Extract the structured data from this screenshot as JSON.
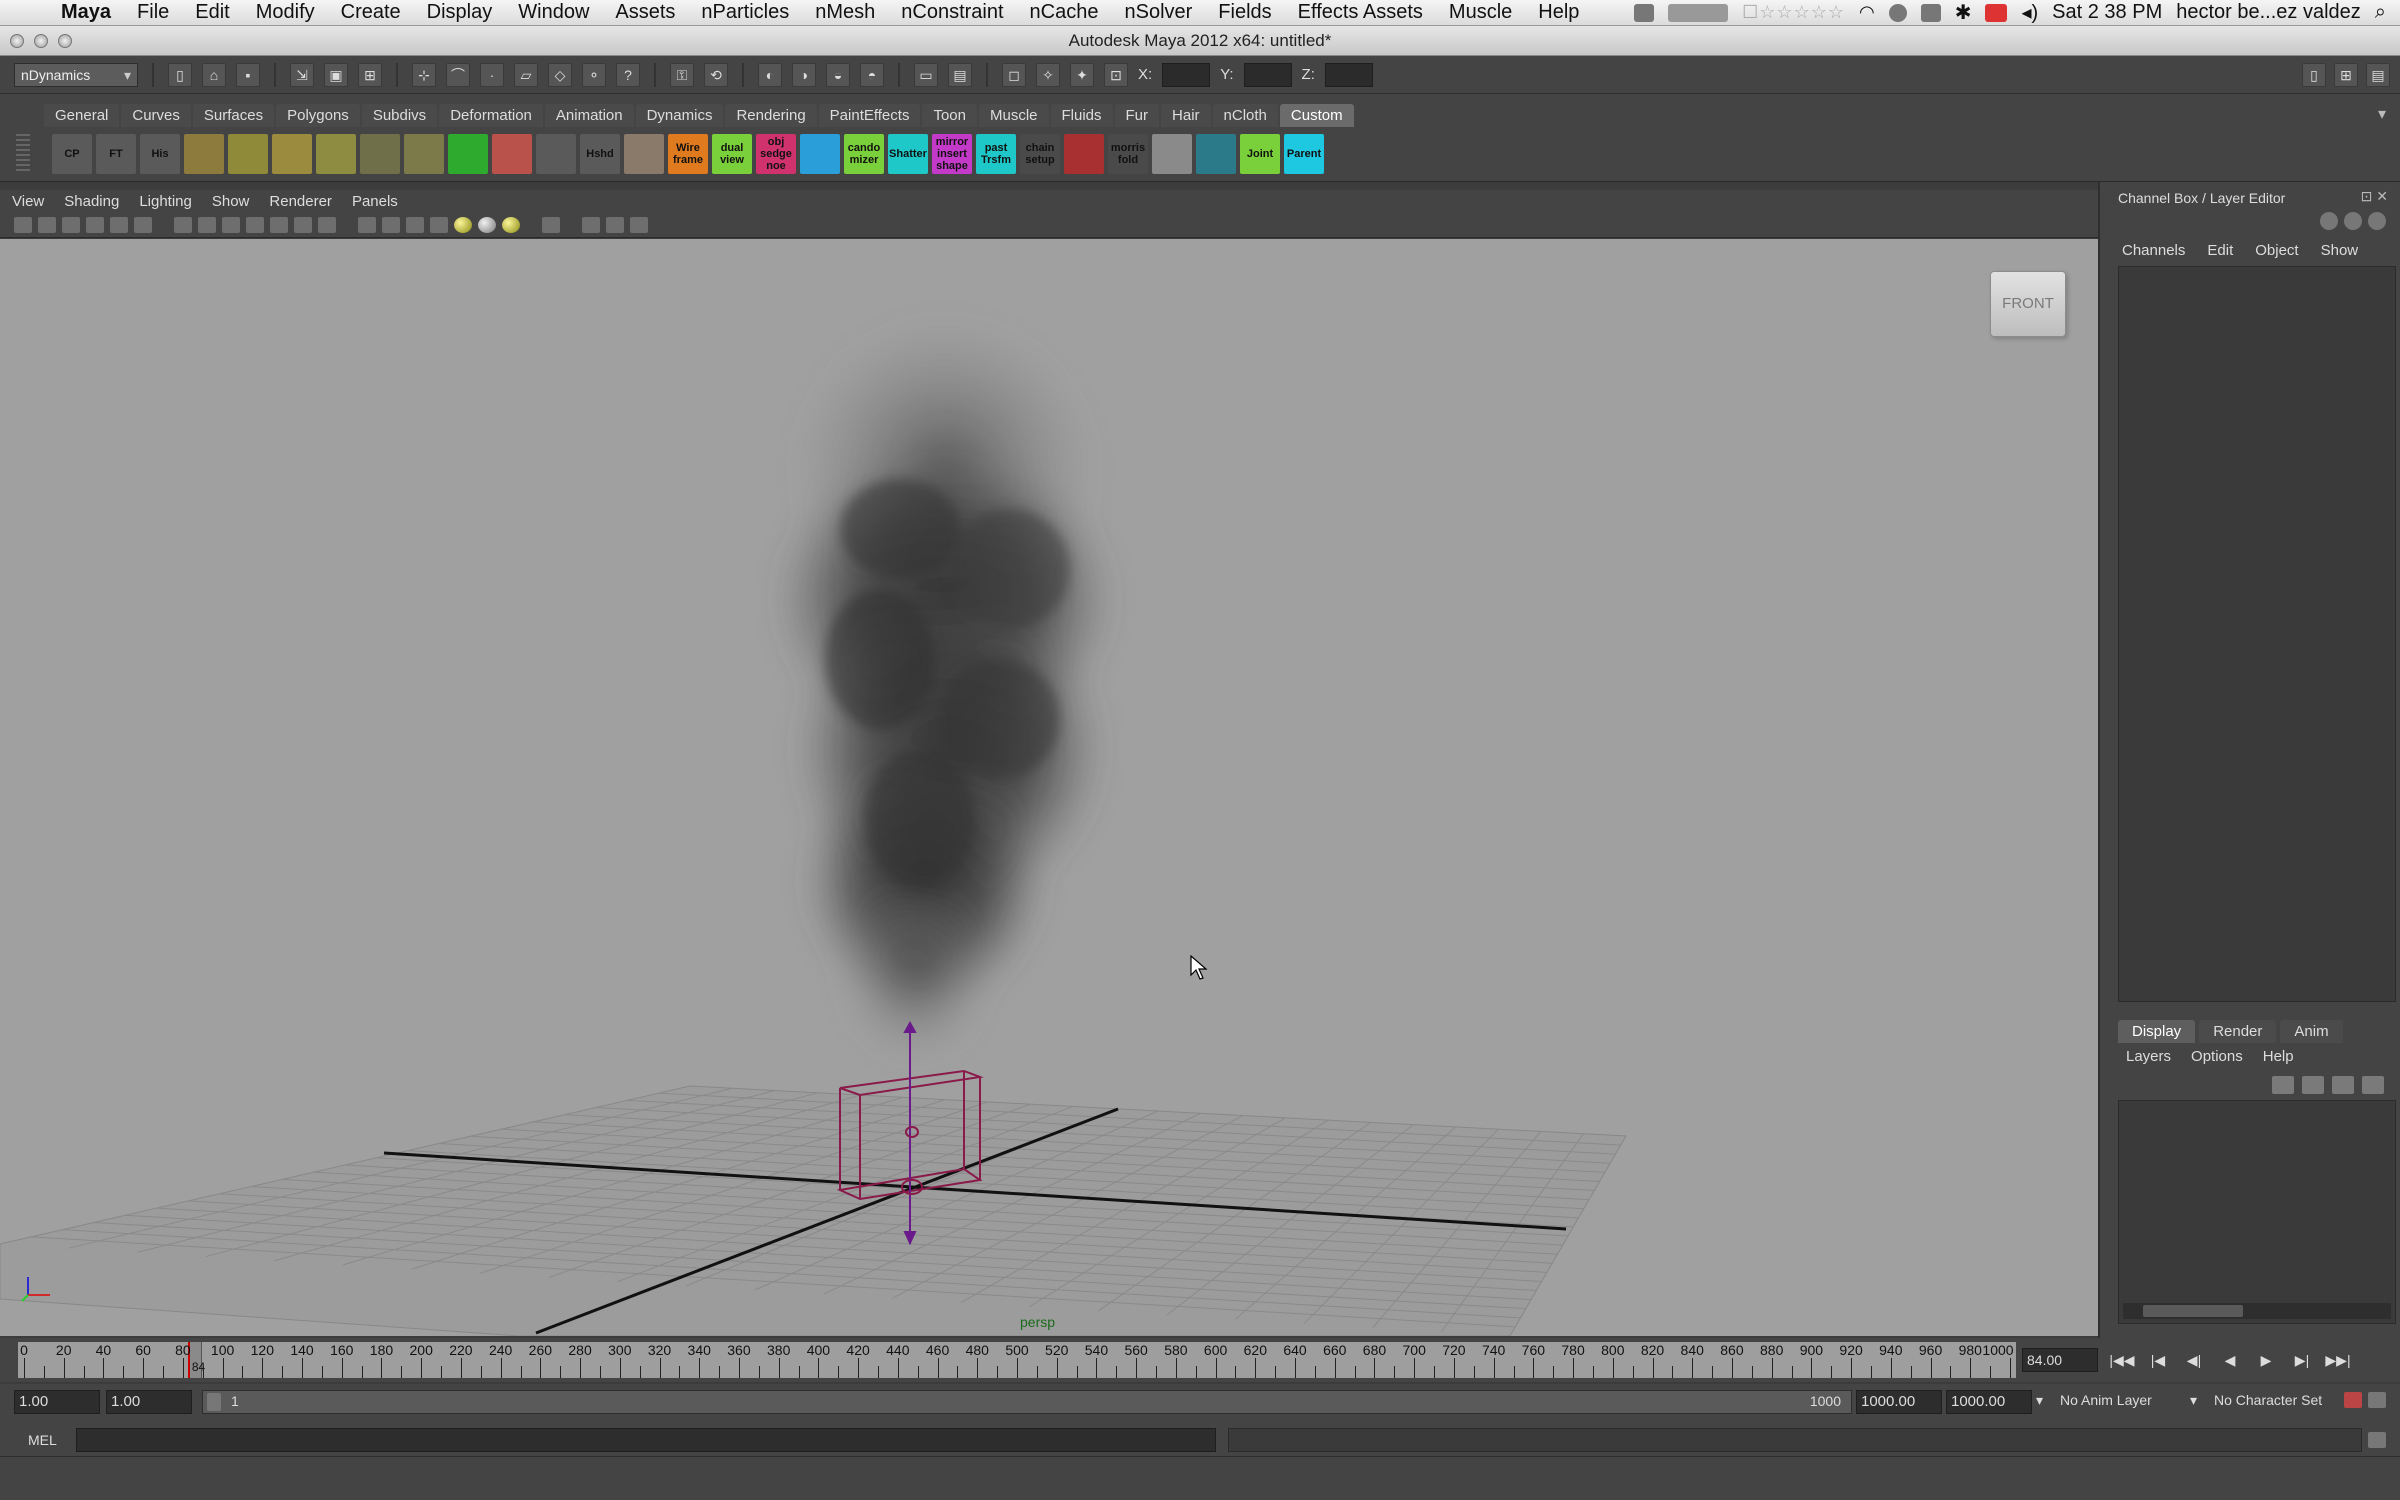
{
  "menubar": {
    "app": "Maya",
    "items": [
      "File",
      "Edit",
      "Modify",
      "Create",
      "Display",
      "Window",
      "Assets",
      "nParticles",
      "nMesh",
      "nConstraint",
      "nCache",
      "nSolver",
      "Fields",
      "Effects Assets",
      "Muscle",
      "Help"
    ],
    "clock": "Sat 2 38 PM",
    "user": "hector be...ez valdez"
  },
  "window": {
    "title": "Autodesk Maya 2012 x64: untitled*"
  },
  "statusline": {
    "menuset": "nDynamics",
    "x_label": "X:",
    "y_label": "Y:",
    "z_label": "Z:"
  },
  "shelf": {
    "tabs": [
      "General",
      "Curves",
      "Surfaces",
      "Polygons",
      "Subdivs",
      "Deformation",
      "Animation",
      "Dynamics",
      "Rendering",
      "PaintEffects",
      "Toon",
      "Muscle",
      "Fluids",
      "Fur",
      "Hair",
      "nCloth",
      "Custom"
    ],
    "active_tab": "Custom",
    "buttons": [
      {
        "label": "CP",
        "color": "#5a5a5a"
      },
      {
        "label": "FT",
        "color": "#5a5a5a"
      },
      {
        "label": "His",
        "color": "#5a5a5a"
      },
      {
        "label": "",
        "color": "#8c7b3c"
      },
      {
        "label": "",
        "color": "#8f8a3a"
      },
      {
        "label": "",
        "color": "#9a8b3e"
      },
      {
        "label": "",
        "color": "#8e8c40"
      },
      {
        "label": "",
        "color": "#6f6f4a"
      },
      {
        "label": "",
        "color": "#7d7a4a"
      },
      {
        "label": "",
        "color": "#2eaa2e"
      },
      {
        "label": "",
        "color": "#b9524a"
      },
      {
        "label": "",
        "color": "#5a5a5a"
      },
      {
        "label": "Hshd",
        "color": "#5a5a5a"
      },
      {
        "label": "",
        "color": "#8a7a6a"
      },
      {
        "label": "Wire frame",
        "color": "#e07a1e"
      },
      {
        "label": "dual view",
        "color": "#7ad03a"
      },
      {
        "label": "obj sedge noe",
        "color": "#d0326e"
      },
      {
        "label": "",
        "color": "#2a9ed8"
      },
      {
        "label": "cando mizer",
        "color": "#7ad03a"
      },
      {
        "label": "Shatter",
        "color": "#1ec8c8"
      },
      {
        "label": "mirror insert shape",
        "color": "#c43ac8"
      },
      {
        "label": "past Trsfm",
        "color": "#1ec8c8"
      },
      {
        "label": "chain setup",
        "color": "#4a4a4a"
      },
      {
        "label": "",
        "color": "#a83030"
      },
      {
        "label": "morris fold",
        "color": "#4a4a4a"
      },
      {
        "label": "",
        "color": "#8a8a8a"
      },
      {
        "label": "",
        "color": "#2a7a8a"
      },
      {
        "label": "Joint",
        "color": "#7ad03a"
      },
      {
        "label": "Parent",
        "color": "#1ec8e0"
      }
    ]
  },
  "panel": {
    "menu": [
      "View",
      "Shading",
      "Lighting",
      "Show",
      "Renderer",
      "Panels"
    ],
    "viewcube_label": "FRONT",
    "camera": "persp"
  },
  "channelbox": {
    "title": "Channel Box / Layer Editor",
    "menu": [
      "Channels",
      "Edit",
      "Object",
      "Show"
    ],
    "layer_tabs": [
      "Display",
      "Render",
      "Anim"
    ],
    "layer_menu": [
      "Layers",
      "Options",
      "Help"
    ]
  },
  "timeslider": {
    "ticks": [
      "0",
      "20",
      "40",
      "60",
      "80",
      "100",
      "120",
      "140",
      "160",
      "180",
      "200",
      "220",
      "240",
      "260",
      "280",
      "300",
      "320",
      "340",
      "360",
      "380",
      "400",
      "420",
      "440",
      "460",
      "480",
      "500",
      "520",
      "540",
      "560",
      "580",
      "600",
      "620",
      "640",
      "660",
      "680",
      "700",
      "720",
      "740",
      "760",
      "780",
      "800",
      "820",
      "840",
      "860",
      "880",
      "900",
      "920",
      "940",
      "960",
      "980",
      "1000"
    ],
    "current_frame_marker": "84",
    "current_frame": "84.00"
  },
  "rangeslider": {
    "start_time": "1.00",
    "playback_start": "1.00",
    "range_start": "1",
    "range_end": "1000",
    "playback_end": "1000.00",
    "end_time": "1000.00",
    "anim_layer": "No Anim Layer",
    "character_set": "No Character Set"
  },
  "cmdline": {
    "label": "MEL"
  }
}
